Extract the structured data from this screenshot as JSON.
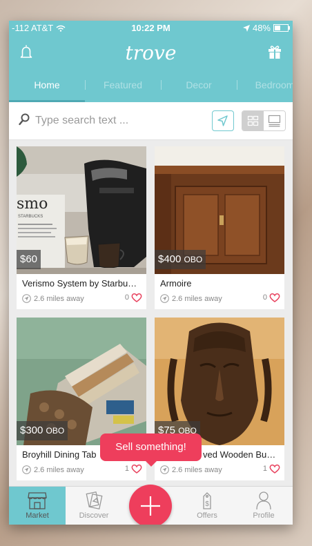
{
  "status_bar": {
    "carrier": "-112 AT&T",
    "time": "10:22 PM",
    "battery_percent": "48%",
    "battery_level": 0.48
  },
  "header": {
    "logo": "trove",
    "bell_icon": "bell-icon",
    "gift_icon": "gift-icon"
  },
  "tabs": [
    {
      "label": "Home",
      "active": true
    },
    {
      "label": "Featured"
    },
    {
      "label": "Decor"
    },
    {
      "label": "Bedroom"
    }
  ],
  "search": {
    "placeholder": "Type search text ..."
  },
  "listings": [
    {
      "price": "$60",
      "obo": "",
      "title": "Verismo System by Starbu…",
      "distance": "2.6 miles away",
      "likes": "0"
    },
    {
      "price": "$400",
      "obo": "OBO",
      "title": "Armoire",
      "distance": "2.6 miles away",
      "likes": "0"
    },
    {
      "price": "$300",
      "obo": "OBO",
      "title": "Broyhill Dining Tab",
      "distance": "2.6 miles away",
      "likes": "1"
    },
    {
      "price": "$75",
      "obo": "OBO",
      "title": "ved Wooden Bu…",
      "distance": "2.6 miles away",
      "likes": "1"
    }
  ],
  "tooltip": {
    "text": "Sell something!"
  },
  "tabbar": [
    {
      "label": "Market",
      "active": true
    },
    {
      "label": "Discover"
    },
    {
      "label": "Offers"
    },
    {
      "label": "Profile"
    }
  ],
  "colors": {
    "accent": "#6fc8cf",
    "sell": "#ee3e5c",
    "heart": "#e8435f"
  }
}
